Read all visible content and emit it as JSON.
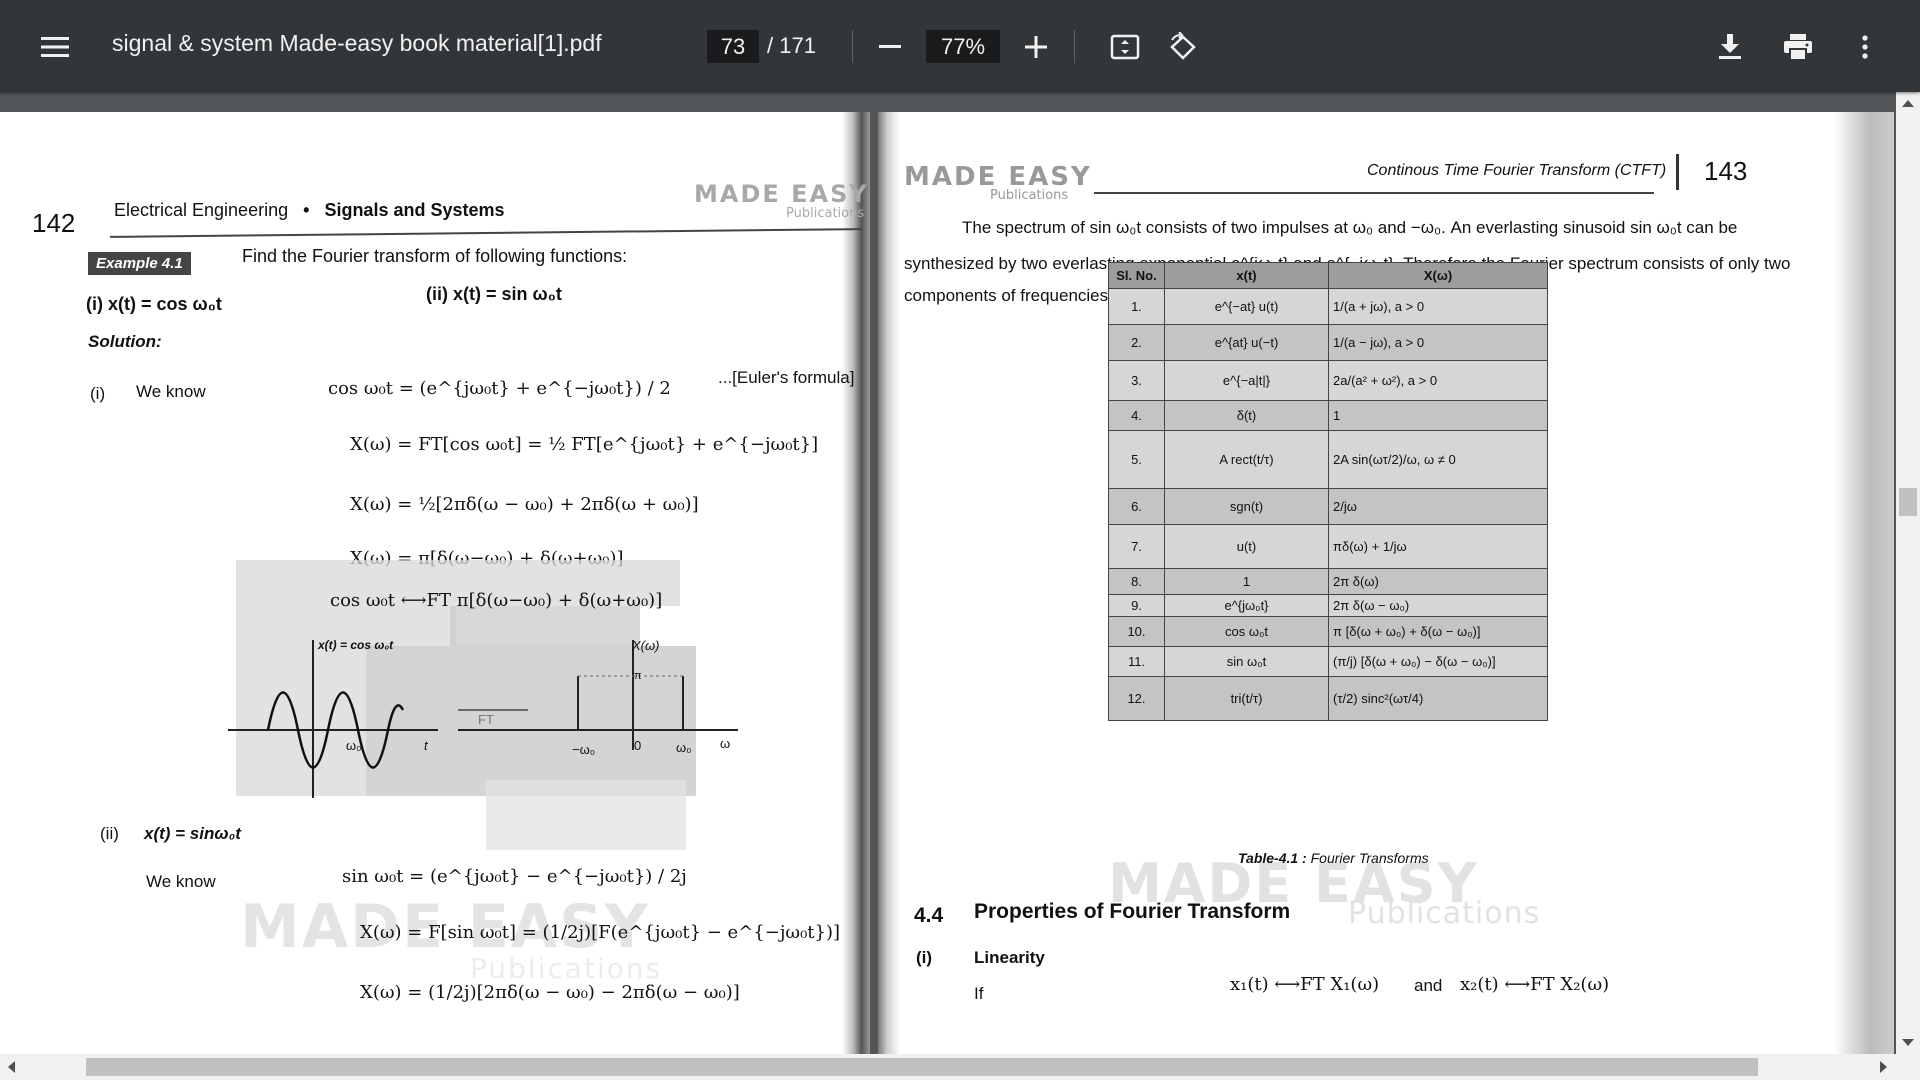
{
  "toolbar": {
    "title": "signal & system Made-easy book material[1].pdf",
    "current_page": "73",
    "total_pages": "/ 171",
    "zoom": "77%"
  },
  "icons": [
    "menu-icon",
    "zoom-out-icon",
    "zoom-in-icon",
    "fit-page-icon",
    "rotate-icon",
    "download-icon",
    "print-icon",
    "more-options-icon"
  ],
  "left_page": {
    "page_number": "142",
    "header_subject": "Electrical Engineering",
    "header_bullet": "•",
    "header_topic": "Signals and Systems",
    "watermark": "MADE EASY",
    "watermark_sub": "Publications",
    "example_badge": "Example 4.1",
    "example_title": "Find the Fourier transform of following functions:",
    "part_i": "(i) x(t) = cos ω₀t",
    "part_ii": "(ii) x(t) = sin ω₀t",
    "solution": "Solution:",
    "i_label": "(i)",
    "we_know_1": "We know",
    "eq1": "cos ω₀t = (e^{jω₀t} + e^{−jω₀t}) / 2",
    "euler": "...[Euler's formula]",
    "eq2": "X(ω) = FT[cos ω₀t] = ½ FT[e^{jω₀t} + e^{−jω₀t}]",
    "eq3": "X(ω) = ½[2πδ(ω − ω₀) + 2πδ(ω + ω₀)]",
    "eq4": "X(ω) = π[δ(ω−ω₀) + δ(ω+ω₀)]",
    "eq5": "cos ω₀t ⟷FT π[δ(ω−ω₀) + δ(ω+ω₀)]",
    "plot_x_label": "x(t) = cos ω₀t",
    "plot_X_label": "X(ω)",
    "plot_ft": "FT",
    "plot_w0": "ω₀",
    "plot_t": "t",
    "plot_minus_w0": "−ω₀",
    "plot_zero": "0",
    "plot_w0_right": "ω₀",
    "plot_w": "ω",
    "plot_pi": "π",
    "ii_label": "(ii)",
    "ii_func": "x(t) = sinω₀t",
    "we_know_2": "We know",
    "eq6": "sin ω₀t = (e^{jω₀t} − e^{−jω₀t}) / 2j",
    "eq7": "X(ω) = F[sin ω₀t] = (1/2j)[F(e^{jω₀t} − e^{−jω₀t})]",
    "eq8": "X(ω) = (1/2j)[2πδ(ω − ω₀) − 2πδ(ω − ω₀)]"
  },
  "right_page": {
    "page_number": "143",
    "header_title": "Continous Time Fourier Transform (CTFT)",
    "watermark": "MADE EASY",
    "watermark_sub": "Publications",
    "para_1": "The spectrum of sin ω₀t consists of two impulses at ω₀ and −ω₀. An everlasting sinusoid sin ω₀t can be",
    "para_2": "synthesized by two everlasting exponential e^{jω₀t} and e^{−jω₀t}. Therefore the Fourier spectrum consists of only two",
    "para_3": "components of frequencies ω₀ and −ω₀.",
    "table_headers": [
      "Sl. No.",
      "x(t)",
      "X(ω)"
    ],
    "table_rows": [
      [
        "1.",
        "e^{−at} u(t)",
        "1/(a + jω),   a > 0"
      ],
      [
        "2.",
        "e^{at} u(−t)",
        "1/(a − jω),   a > 0"
      ],
      [
        "3.",
        "e^{−a|t|}",
        "2a/(a² + ω²),   a > 0"
      ],
      [
        "4.",
        "δ(t)",
        "1"
      ],
      [
        "5.",
        "A rect(t/τ)",
        "2A sin(ωτ/2)/ω,   ω ≠ 0"
      ],
      [
        "6.",
        "sgn(t)",
        "2/jω"
      ],
      [
        "7.",
        "u(t)",
        "πδ(ω) + 1/jω"
      ],
      [
        "8.",
        "1",
        "2π δ(ω)"
      ],
      [
        "9.",
        "e^{jω₀t}",
        "2π δ(ω − ω₀)"
      ],
      [
        "10.",
        "cos ω₀t",
        "π [δ(ω + ω₀) + δ(ω − ω₀)]"
      ],
      [
        "11.",
        "sin ω₀t",
        "(π/j) [δ(ω + ω₀) − δ(ω − ω₀)]"
      ],
      [
        "12.",
        "tri(t/τ)",
        "(τ/2) sinc²(ωτ/4)"
      ]
    ],
    "table_caption_bold": "Table-4.1 :",
    "table_caption": "Fourier Transforms",
    "section_num": "4.4",
    "section_title": "Properties of Fourier Transform",
    "sub_label": "(i)",
    "sub_title": "Linearity",
    "if_text": "If",
    "linearity_1": "x₁(t) ⟷FT X₁(ω)",
    "and_text": "and",
    "linearity_2": "x₂(t) ⟷FT X₂(ω)"
  }
}
